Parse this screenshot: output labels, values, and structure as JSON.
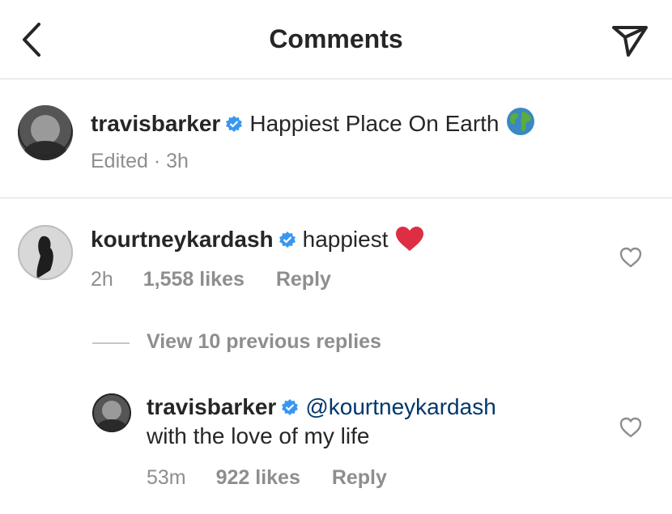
{
  "header": {
    "title": "Comments"
  },
  "post": {
    "username": "travisbarker",
    "caption": "Happiest Place On Earth",
    "edited": "Edited",
    "time": "3h"
  },
  "comment": {
    "username": "kourtneykardash",
    "text": "happiest",
    "time": "2h",
    "likes": "1,558 likes",
    "reply": "Reply"
  },
  "thread": {
    "view_replies": "View 10 previous replies"
  },
  "reply": {
    "username": "travisbarker",
    "mention": "@kourtneykardash",
    "text": "with the love of my life",
    "time": "53m",
    "likes": "922 likes",
    "reply": "Reply"
  },
  "colors": {
    "verified": "#3897f0",
    "heart": "#ed4956",
    "link": "#00376b",
    "muted": "#8e8e8e"
  },
  "icons": [
    "back-arrow-icon",
    "send-icon",
    "verified-badge-icon",
    "globe-emoji-icon",
    "red-heart-emoji-icon",
    "heart-outline-icon"
  ]
}
